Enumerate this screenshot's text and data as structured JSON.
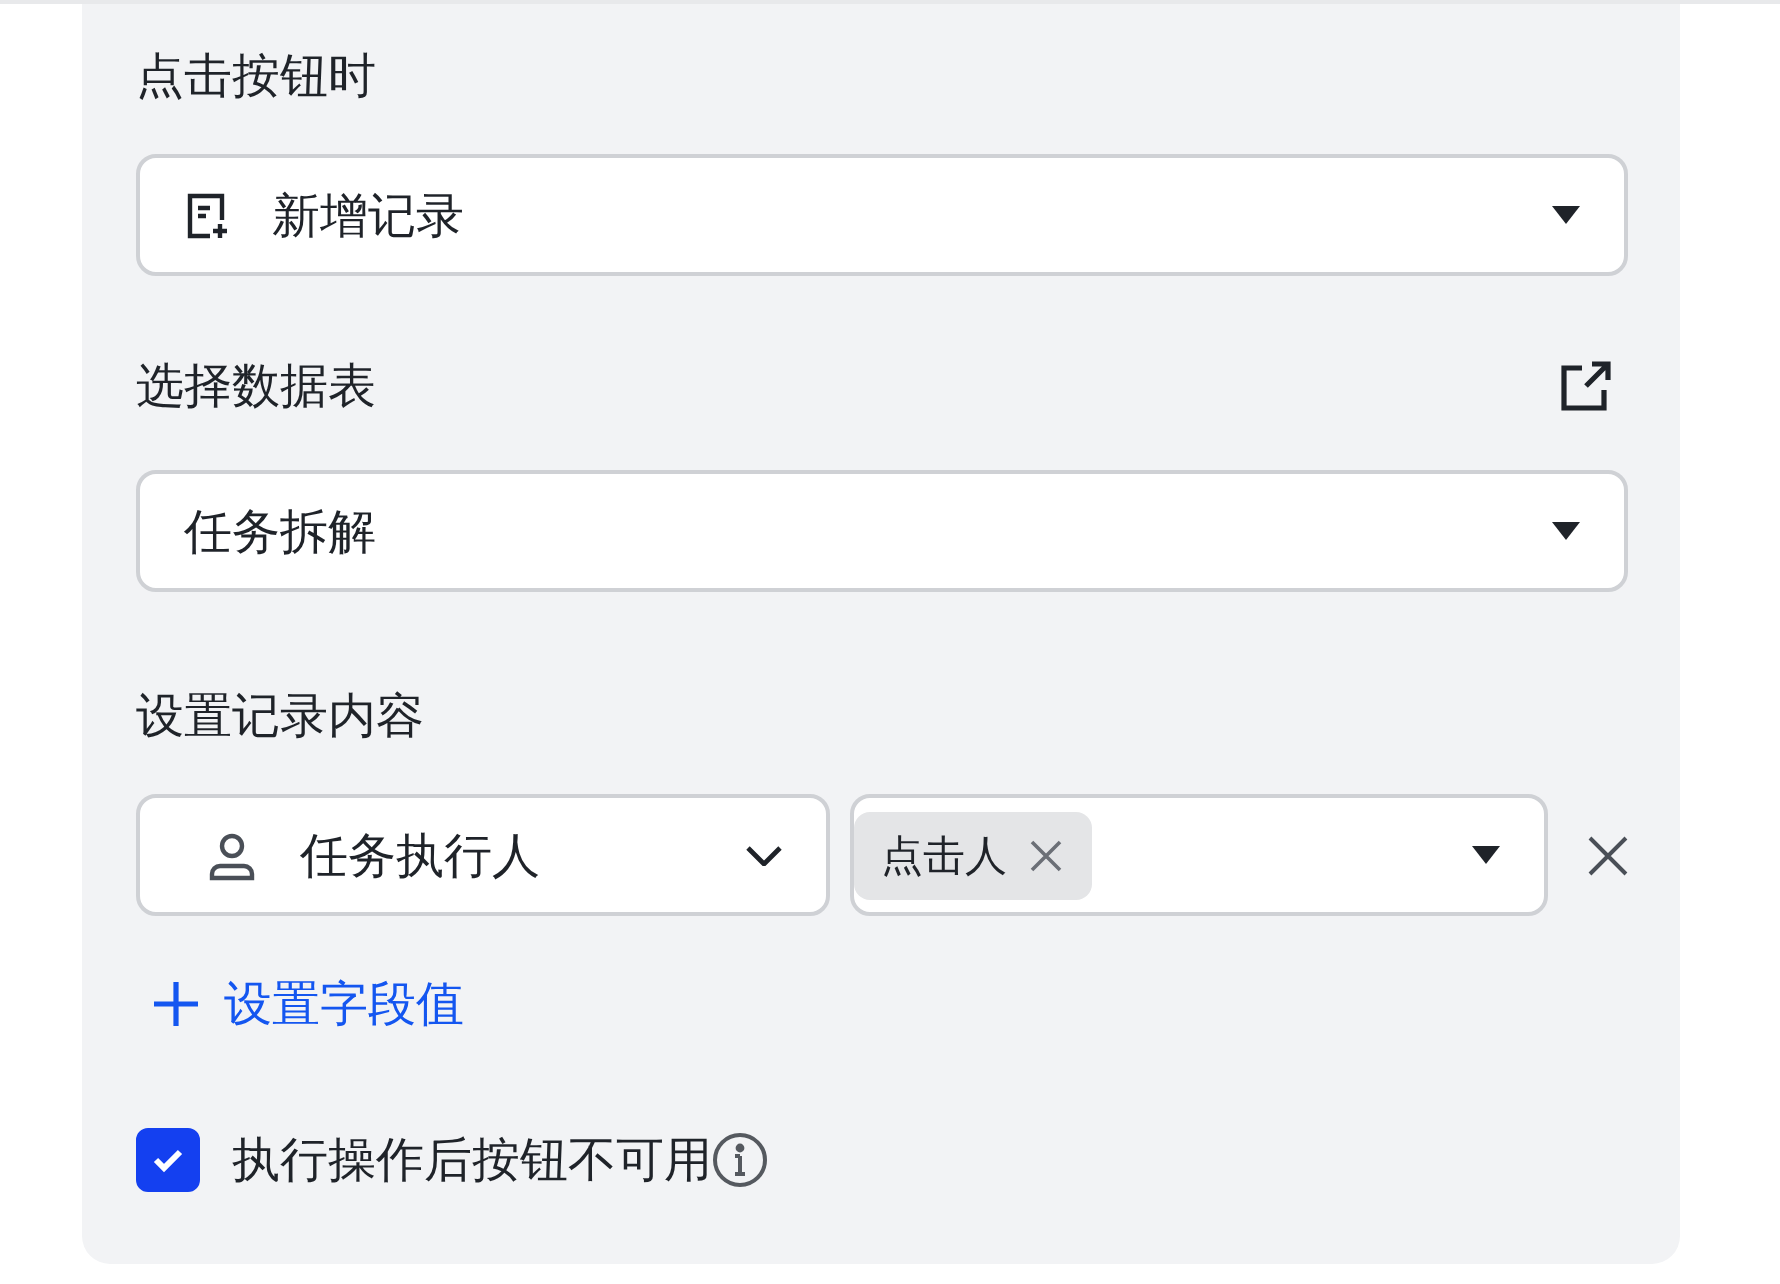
{
  "action": {
    "label": "点击按钮时",
    "value": "新增记录"
  },
  "table": {
    "label": "选择数据表",
    "value": "任务拆解"
  },
  "content": {
    "label": "设置记录内容",
    "fields": [
      {
        "field": "任务执行人",
        "tags": [
          "点击人"
        ]
      }
    ],
    "add_link": "设置字段值"
  },
  "disable_after": {
    "label": "执行操作后按钮不可用",
    "checked": true
  }
}
